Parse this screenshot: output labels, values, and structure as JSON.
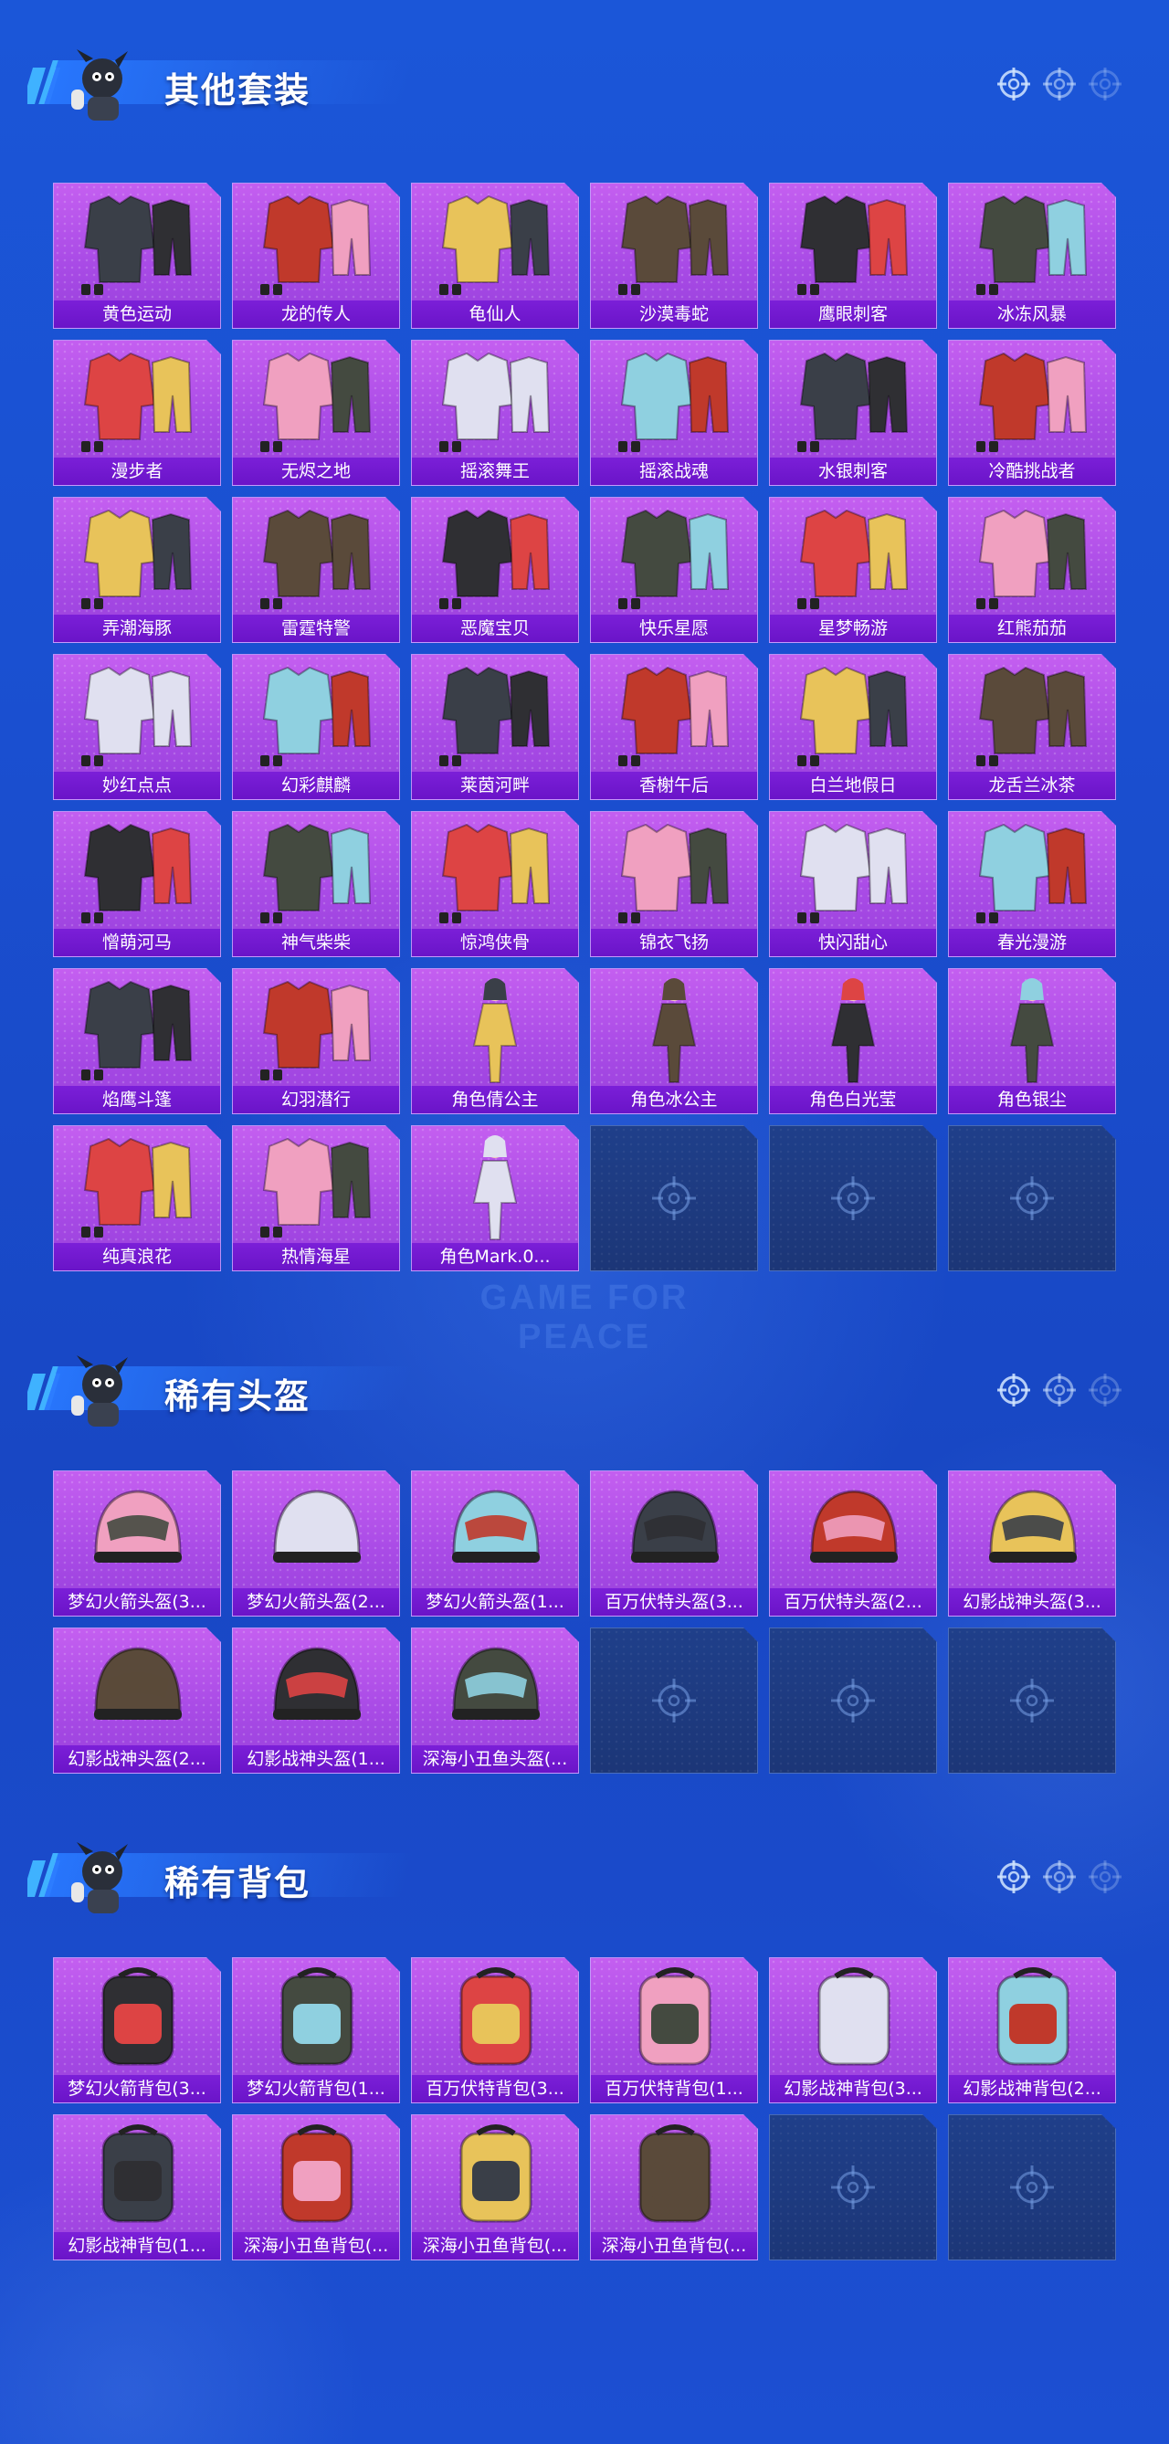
{
  "watermark": "GAME FOR PEACE",
  "sections": [
    {
      "title": "其他套装",
      "items": [
        {
          "name": "黄色运动",
          "art": "outfit"
        },
        {
          "name": "龙的传人",
          "art": "outfit"
        },
        {
          "name": "龟仙人",
          "art": "outfit"
        },
        {
          "name": "沙漠毒蛇",
          "art": "outfit"
        },
        {
          "name": "鹰眼刺客",
          "art": "outfit"
        },
        {
          "name": "冰冻风暴",
          "art": "outfit"
        },
        {
          "name": "漫步者",
          "art": "outfit"
        },
        {
          "name": "无烬之地",
          "art": "outfit"
        },
        {
          "name": "摇滚舞王",
          "art": "outfit"
        },
        {
          "name": "摇滚战魂",
          "art": "outfit"
        },
        {
          "name": "水银刺客",
          "art": "outfit"
        },
        {
          "name": "冷酷挑战者",
          "art": "outfit"
        },
        {
          "name": "弄潮海豚",
          "art": "outfit"
        },
        {
          "name": "雷霆特警",
          "art": "outfit"
        },
        {
          "name": "恶魔宝贝",
          "art": "outfit"
        },
        {
          "name": "快乐星愿",
          "art": "outfit"
        },
        {
          "name": "星梦畅游",
          "art": "outfit"
        },
        {
          "name": "红熊茄茄",
          "art": "outfit"
        },
        {
          "name": "妙红点点",
          "art": "outfit"
        },
        {
          "name": "幻彩麒麟",
          "art": "outfit"
        },
        {
          "name": "莱茵河畔",
          "art": "outfit"
        },
        {
          "name": "香榭午后",
          "art": "outfit"
        },
        {
          "name": "白兰地假日",
          "art": "outfit"
        },
        {
          "name": "龙舌兰冰茶",
          "art": "outfit"
        },
        {
          "name": "憎萌河马",
          "art": "outfit"
        },
        {
          "name": "神气柴柴",
          "art": "outfit"
        },
        {
          "name": "惊鸿侠骨",
          "art": "outfit"
        },
        {
          "name": "锦衣飞扬",
          "art": "outfit"
        },
        {
          "name": "快闪甜心",
          "art": "outfit"
        },
        {
          "name": "春光漫游",
          "art": "outfit"
        },
        {
          "name": "焰鹰斗篷",
          "art": "outfit"
        },
        {
          "name": "幻羽潜行",
          "art": "outfit"
        },
        {
          "name": "角色倩公主",
          "art": "figure"
        },
        {
          "name": "角色冰公主",
          "art": "figure"
        },
        {
          "name": "角色白光莹",
          "art": "figure"
        },
        {
          "name": "角色银尘",
          "art": "figure"
        },
        {
          "name": "纯真浪花",
          "art": "outfit"
        },
        {
          "name": "热情海星",
          "art": "outfit"
        },
        {
          "name": "角色Mark.0...",
          "art": "figure"
        },
        {
          "empty": true
        },
        {
          "empty": true
        },
        {
          "empty": true
        }
      ]
    },
    {
      "title": "稀有头盔",
      "items": [
        {
          "name": "梦幻火箭头盔(3...",
          "art": "helmet"
        },
        {
          "name": "梦幻火箭头盔(2...",
          "art": "helmet"
        },
        {
          "name": "梦幻火箭头盔(1...",
          "art": "helmet"
        },
        {
          "name": "百万伏特头盔(3...",
          "art": "helmet"
        },
        {
          "name": "百万伏特头盔(2...",
          "art": "helmet"
        },
        {
          "name": "幻影战神头盔(3...",
          "art": "helmet"
        },
        {
          "name": "幻影战神头盔(2...",
          "art": "helmet"
        },
        {
          "name": "幻影战神头盔(1...",
          "art": "helmet"
        },
        {
          "name": "深海小丑鱼头盔(...",
          "art": "helmet"
        },
        {
          "empty": true
        },
        {
          "empty": true
        },
        {
          "empty": true
        }
      ]
    },
    {
      "title": "稀有背包",
      "items": [
        {
          "name": "梦幻火箭背包(3...",
          "art": "backpack"
        },
        {
          "name": "梦幻火箭背包(1...",
          "art": "backpack"
        },
        {
          "name": "百万伏特背包(3...",
          "art": "backpack"
        },
        {
          "name": "百万伏特背包(1...",
          "art": "backpack"
        },
        {
          "name": "幻影战神背包(3...",
          "art": "backpack"
        },
        {
          "name": "幻影战神背包(2...",
          "art": "backpack"
        },
        {
          "name": "幻影战神背包(1...",
          "art": "backpack"
        },
        {
          "name": "深海小丑鱼背包(...",
          "art": "backpack"
        },
        {
          "name": "深海小丑鱼背包(...",
          "art": "backpack"
        },
        {
          "name": "深海小丑鱼背包(...",
          "art": "backpack"
        },
        {
          "empty": true
        },
        {
          "empty": true
        }
      ]
    }
  ]
}
